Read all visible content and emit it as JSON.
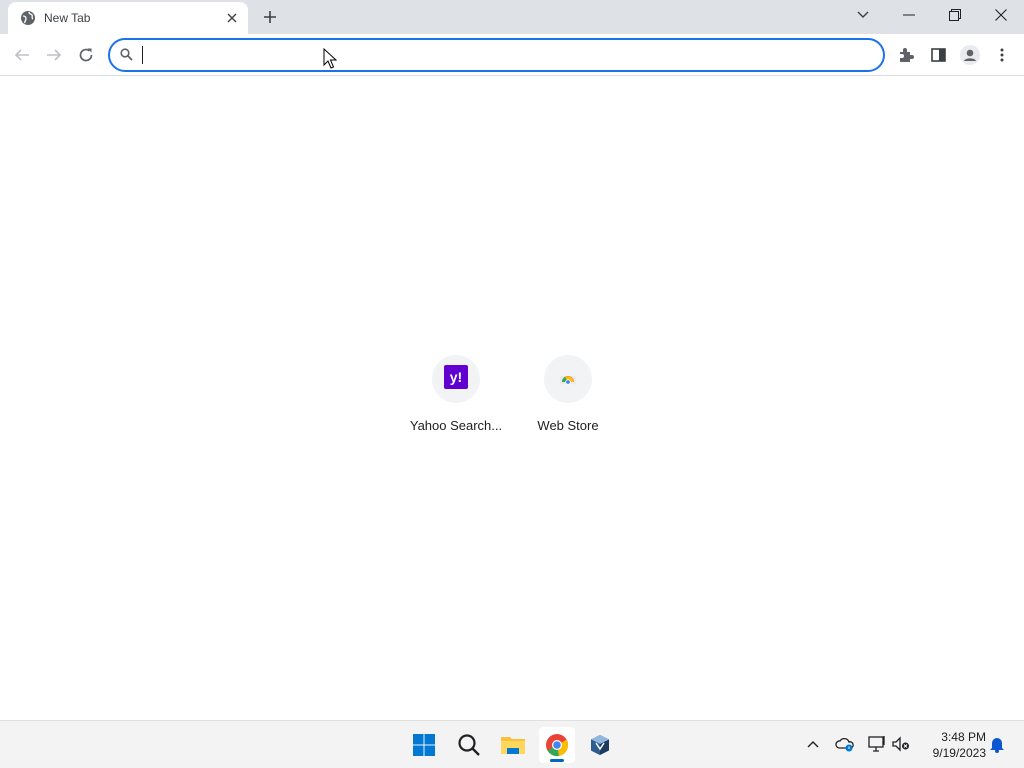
{
  "browser": {
    "tab": {
      "title": "New Tab",
      "favicon": "globe-icon"
    },
    "colors": {
      "accent": "#1a73e8",
      "tabstrip": "#dee1e6"
    }
  },
  "toolbar": {
    "omnibox": {
      "value": "",
      "placeholder": ""
    }
  },
  "shortcuts": [
    {
      "label": "Yahoo Search...",
      "icon": "yahoo-icon",
      "color": "#6001d2"
    },
    {
      "label": "Web Store",
      "icon": "chrome-web-store-icon"
    }
  ],
  "taskbar": {
    "apps": [
      "start-icon",
      "search-icon",
      "file-explorer-icon",
      "chrome-icon",
      "virtualbox-icon"
    ],
    "clock": {
      "time": "3:48 PM",
      "date": "9/19/2023"
    }
  }
}
